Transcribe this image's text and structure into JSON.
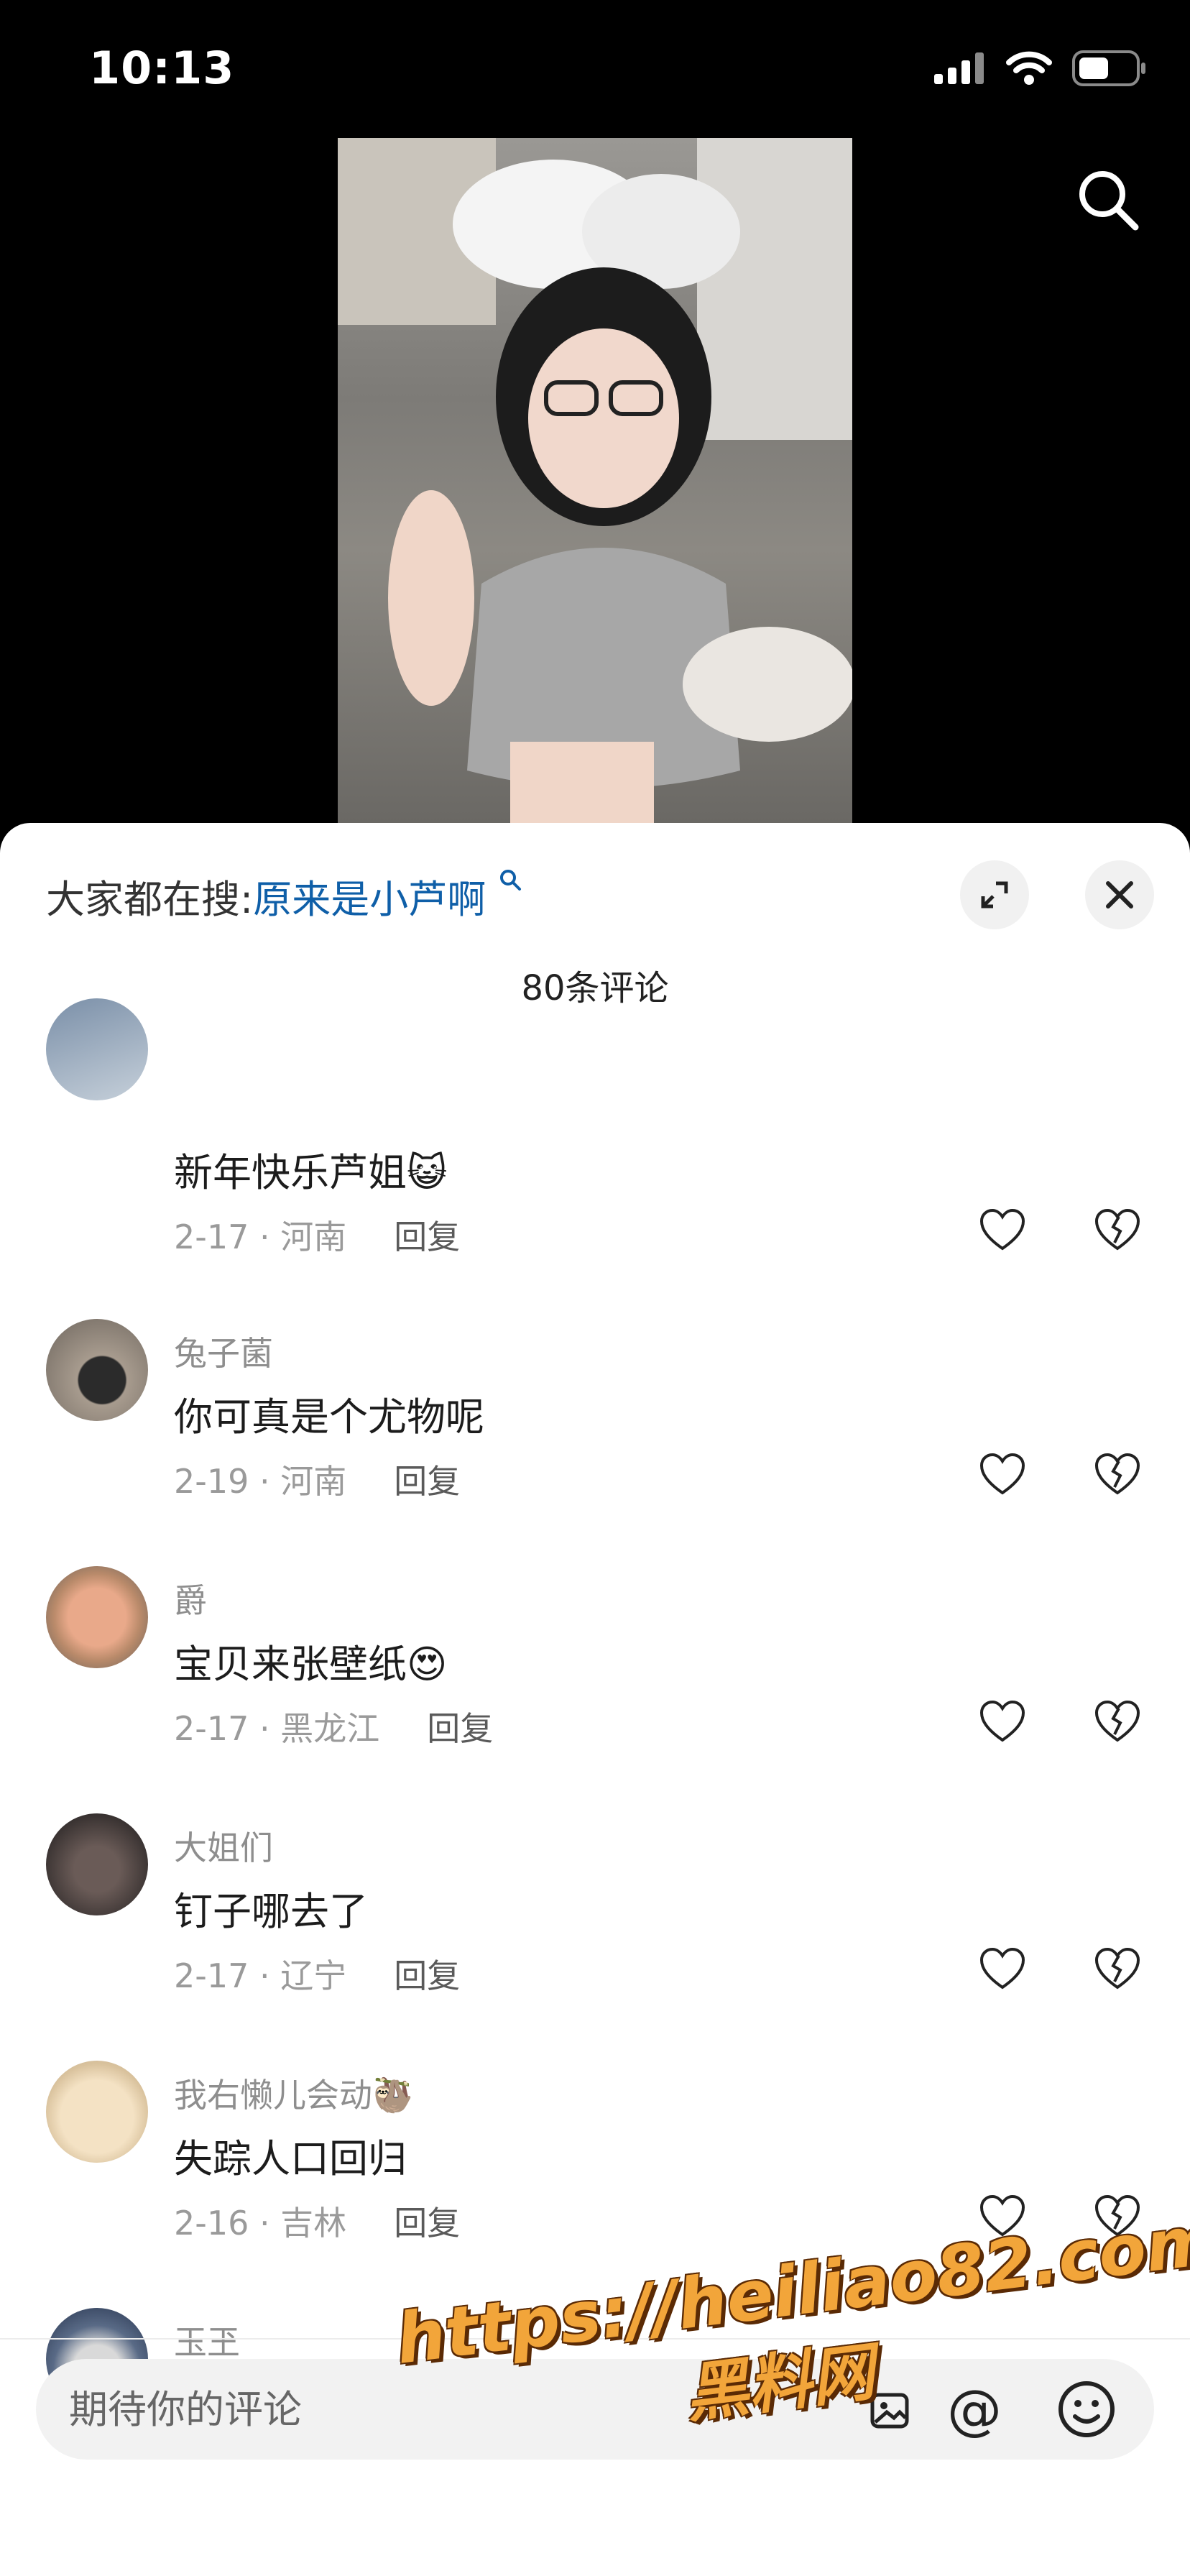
{
  "status_bar": {
    "time": "10:13"
  },
  "trending": {
    "prefix": "大家都在搜:",
    "keyword": "原来是小芦啊"
  },
  "comment_count": "80条评论",
  "comments": [
    {
      "username": "",
      "text": "新年快乐芦姐",
      "emoji": "😺",
      "date": "2-17",
      "region": "河南",
      "reply": "回复"
    },
    {
      "username": "兔子菌",
      "text": "你可真是个尤物呢",
      "emoji": "",
      "date": "2-19",
      "region": "河南",
      "reply": "回复"
    },
    {
      "username": "爵",
      "text": "宝贝来张壁纸",
      "emoji": "😍",
      "date": "2-17",
      "region": "黑龙江",
      "reply": "回复"
    },
    {
      "username": "大姐们",
      "text": "钉子哪去了",
      "emoji": "",
      "date": "2-17",
      "region": "辽宁",
      "reply": "回复"
    },
    {
      "username": "我右懒儿会动",
      "username_emoji": "🦥",
      "text": "失踪人口回归",
      "emoji": "",
      "date": "2-16",
      "region": "吉林",
      "reply": "回复"
    },
    {
      "username": "玉玊",
      "text": "🌹 🌹 🌹",
      "emoji": "",
      "date": "",
      "region": "",
      "reply": ""
    }
  ],
  "input": {
    "placeholder": "期待你的评论",
    "at_symbol": "@"
  },
  "watermark": {
    "url": "https://heiliao82.com",
    "name": "黑料网"
  },
  "colors": {
    "accent_link": "#0f5fa8",
    "watermark": "#f2a53a"
  }
}
